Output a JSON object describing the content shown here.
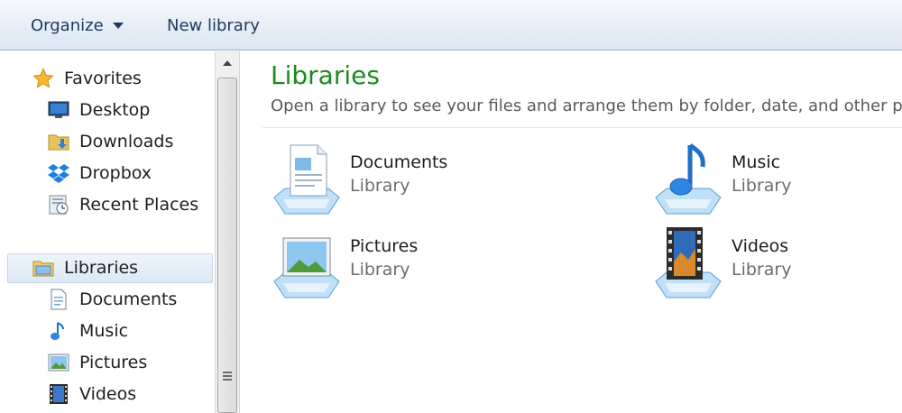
{
  "toolbar": {
    "organize": "Organize",
    "new_library": "New library"
  },
  "nav": {
    "favorites": {
      "label": "Favorites",
      "items": [
        {
          "label": "Desktop",
          "icon": "desktop-icon"
        },
        {
          "label": "Downloads",
          "icon": "downloads-folder-icon"
        },
        {
          "label": "Dropbox",
          "icon": "dropbox-icon"
        },
        {
          "label": "Recent Places",
          "icon": "recent-places-icon"
        }
      ]
    },
    "libraries": {
      "label": "Libraries",
      "items": [
        {
          "label": "Documents",
          "icon": "document-icon"
        },
        {
          "label": "Music",
          "icon": "music-note-icon"
        },
        {
          "label": "Pictures",
          "icon": "picture-icon"
        },
        {
          "label": "Videos",
          "icon": "film-icon"
        }
      ]
    }
  },
  "content": {
    "title": "Libraries",
    "description": "Open a library to see your files and arrange them by folder, date, and other prop",
    "libraries": [
      {
        "name": "Documents",
        "type": "Library",
        "icon": "documents-library-icon"
      },
      {
        "name": "Music",
        "type": "Library",
        "icon": "music-library-icon"
      },
      {
        "name": "Pictures",
        "type": "Library",
        "icon": "pictures-library-icon"
      },
      {
        "name": "Videos",
        "type": "Library",
        "icon": "videos-library-icon"
      }
    ]
  },
  "colors": {
    "title_green": "#1e8a1e",
    "toolbar_text": "#1e395b",
    "library_type_gray": "#6d6d6d"
  }
}
